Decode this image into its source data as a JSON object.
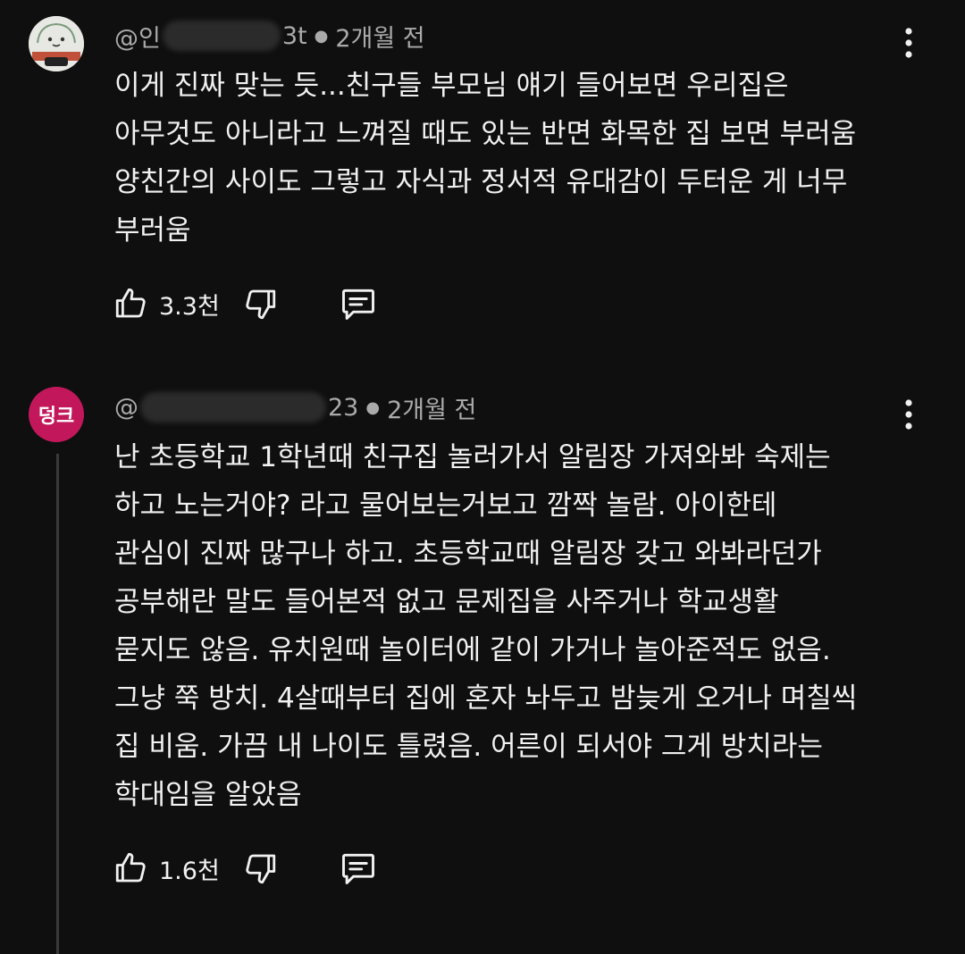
{
  "comments": [
    {
      "handle_visible_start": "@인",
      "handle_visible_end": "3t",
      "time": "2개월 전",
      "lines": [
        "이게 진짜 맞는 듯...친구들 부모님 얘기 들어보면 우리집은",
        "아무것도 아니라고 느껴질 때도 있는 반면 화목한 집 보면 부러움",
        "양친간의 사이도 그렇고 자식과 정서적 유대감이 두터운 게 너무",
        "부러움"
      ],
      "likes": "3.3천"
    },
    {
      "avatar_letter": "덩크",
      "handle_visible_start": "@",
      "handle_visible_end": "23",
      "time": "2개월 전",
      "lines": [
        "난 초등학교 1학년때 친구집 놀러가서 알림장 가져와봐 숙제는",
        "하고 노는거야? 라고 물어보는거보고 깜짝 놀람. 아이한테",
        "관심이 진짜 많구나 하고. 초등학교때 알림장 갖고 와봐라던가",
        "공부해란 말도 들어본적 없고 문제집을 사주거나 학교생활",
        "묻지도 않음. 유치원때 놀이터에 같이 가거나 놀아준적도 없음.",
        "그냥 쭉 방치. 4살때부터 집에 혼자 놔두고 밤늦게 오거나 며칠씩",
        "집 비움. 가끔 내 나이도 틀렸음. 어른이 되서야 그게 방치라는",
        "학대임을 알았음"
      ],
      "likes": "1.6천"
    }
  ],
  "colors": {
    "background": "#0f0f0f",
    "text": "#f1f1f1",
    "meta": "#aaaaaa",
    "avatar2": "#c2185b"
  },
  "icons": [
    "thumb-up-icon",
    "thumb-down-icon",
    "reply-icon",
    "more-vert-icon"
  ]
}
